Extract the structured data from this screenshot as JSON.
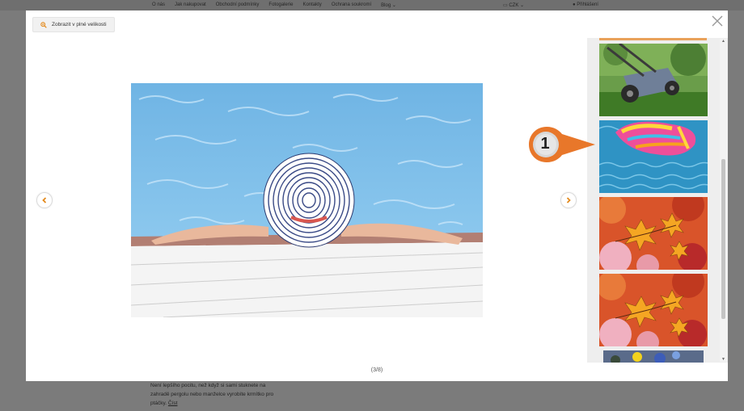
{
  "site": {
    "nav": [
      "O nás",
      "Jak nakupovat",
      "Obchodní podmínky",
      "Fotogalerie",
      "Kontakty",
      "Ochrana soukromí",
      "Blog"
    ],
    "currency": "CZK",
    "login": "Přihlášení",
    "body_text": "Není lepšího pocitu, než když si sami stuknete na zahradě pergolu nebo manželce vyrobíte krmítko pro ptáčky.",
    "body_link": "Číst"
  },
  "lightbox": {
    "zoom_label": "Zobrazit v plné velikosti",
    "counter": "(3/8)",
    "callout_number": "1",
    "thumbnails": [
      "lawnmower",
      "pool float",
      "autumn maple leaves",
      "autumn maple leaves",
      "flowers"
    ],
    "accent_color": "#e38a1d",
    "callout_color": "#e8772a"
  }
}
